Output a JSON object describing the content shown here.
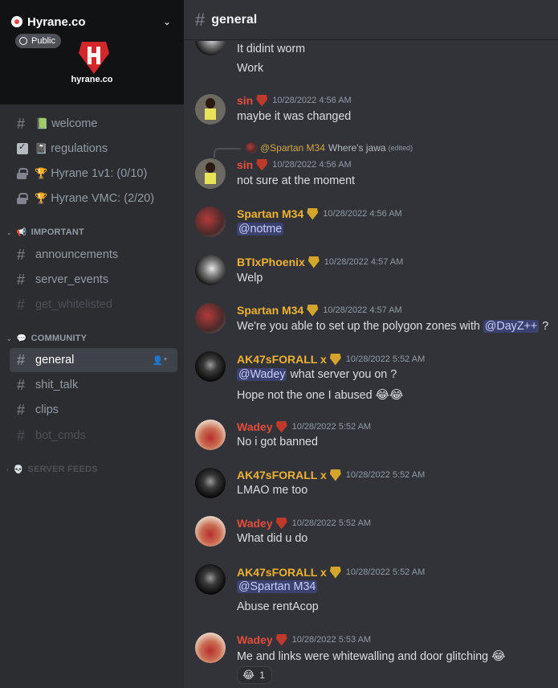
{
  "server": {
    "name": "Hyrane.co",
    "badge": "Public",
    "logo_text": "hyrane.co"
  },
  "channels": [
    {
      "label": "welcome",
      "prefix": "📗",
      "kind": "hash"
    },
    {
      "label": "regulations",
      "prefix": "📓",
      "kind": "check"
    },
    {
      "label": "Hyrane 1v1: (0/10)",
      "prefix": "🏆",
      "kind": "lock"
    },
    {
      "label": "Hyrane VMC: (2/20)",
      "prefix": "🏆",
      "kind": "lock"
    }
  ],
  "categories": [
    {
      "label": "IMPORTANT",
      "icon": "📢",
      "channels": [
        "announcements",
        "server_events",
        "get_whitelisted"
      ]
    },
    {
      "label": "COMMUNITY",
      "icon": "💬",
      "channels": [
        "general",
        "shit_talk",
        "clips",
        "bot_cmds"
      ]
    },
    {
      "label": "SERVER FEEDS",
      "icon": "💀"
    }
  ],
  "header": {
    "channel": "general"
  },
  "messages": [
    {
      "text1": "It didint worm",
      "text2": "Work"
    },
    {
      "user": "sin",
      "time": "10/28/2022 4:56 AM",
      "text": "maybe it was changed"
    },
    {
      "reply_user": "@Spartan M34",
      "reply_text": "Where's jawa",
      "reply_edited": "(edited)",
      "user": "sin",
      "time": "10/28/2022 4:56 AM",
      "text": "not sure at the moment"
    },
    {
      "user": "Spartan M34",
      "time": "10/28/2022 4:56 AM",
      "mention": "@notme"
    },
    {
      "user": "BTIxPhoenix",
      "time": "10/28/2022 4:57 AM",
      "text": "Welp"
    },
    {
      "user": "Spartan M34",
      "time": "10/28/2022 4:57 AM",
      "text": "We're you able to set up the polygon zones with",
      "mention": "@DayZ++",
      "suffix": "?"
    },
    {
      "user": "AK47sFORALL x",
      "time": "10/28/2022 5:52 AM",
      "mention": "@Wadey",
      "text": "what server you on ?",
      "text2": "Hope not the one I abused",
      "emoji2": "😂😂"
    },
    {
      "user": "Wadey",
      "time": "10/28/2022 5:52 AM",
      "text": "No i got banned"
    },
    {
      "user": "AK47sFORALL x",
      "time": "10/28/2022 5:52 AM",
      "text": "LMAO me too"
    },
    {
      "user": "Wadey",
      "time": "10/28/2022 5:52 AM",
      "text": "What did u do"
    },
    {
      "user": "AK47sFORALL x",
      "time": "10/28/2022 5:52 AM",
      "mention": "@Spartan M34",
      "text2": "Abuse rentAcop"
    },
    {
      "user": "Wadey",
      "time": "10/28/2022 5:53 AM",
      "text": "Me and links were whitewalling and door glitching",
      "emoji": "😂",
      "reaction_emoji": "😂",
      "reaction_count": "1"
    }
  ],
  "colors": {
    "sin": "#e74c3c",
    "wadey": "#e74c3c",
    "spartan": "#f0b232",
    "ak": "#f0b232",
    "btix": "#f0b232"
  }
}
